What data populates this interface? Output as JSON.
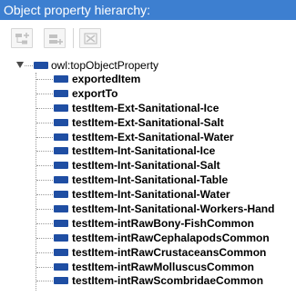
{
  "panel": {
    "title": "Object property hierarchy:"
  },
  "toolbar": {
    "buttons": [
      {
        "name": "add-sub-property-button",
        "icon": "add-sub-property-icon"
      },
      {
        "name": "add-sibling-property-button",
        "icon": "add-sibling-property-icon"
      },
      {
        "name": "delete-property-button",
        "icon": "delete-property-icon"
      }
    ]
  },
  "tree": {
    "root": {
      "label": "owl:topObjectProperty",
      "expanded": true,
      "icon": "object-property-icon"
    },
    "children": [
      "exportedItem",
      "exportTo",
      "testItem-Ext-Sanitational-Ice",
      "testItem-Ext-Sanitational-Salt",
      "testItem-Ext-Sanitational-Water",
      "testItem-Int-Sanitational-Ice",
      "testItem-Int-Sanitational-Salt",
      "testItem-Int-Sanitational-Table",
      "testItem-Int-Sanitational-Water",
      "testItem-Int-Sanitational-Workers-Hand",
      "testItem-intRawBony-FishCommon",
      "testItem-intRawCephalapodsCommon",
      "testItem-intRawCrustaceansCommon",
      "testItem-intRawMolluscusCommon",
      "testItem-intRawScombridaeCommon"
    ]
  },
  "colors": {
    "title_bar": "#3d7fd0",
    "title_text": "#ffffff",
    "property_icon": "#1f4ea3"
  }
}
